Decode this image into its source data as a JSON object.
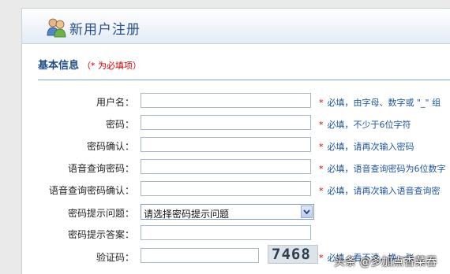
{
  "header": {
    "title": "新用户注册",
    "icon": "users-icon"
  },
  "section": {
    "title": "基本信息",
    "required_note": "（* 为必填项）"
  },
  "form": {
    "star": "*",
    "rows": [
      {
        "label": "用户名：",
        "hint": "必填，由字母、数字或 \"_\" 组"
      },
      {
        "label": "密码：",
        "hint": "必填，不少于6位字符"
      },
      {
        "label": "密码确认：",
        "hint": "必填，请再次输入密码"
      },
      {
        "label": "语音查询密码：",
        "hint": "必填，语音查询密码为6位数字"
      },
      {
        "label": "语音查询密码确认：",
        "hint": "必填，请再次输入语音查询密"
      },
      {
        "label": "密码提示问题：",
        "select_value": "请选择密码提示问题"
      },
      {
        "label": "密码提示答案："
      },
      {
        "label": "验证码：",
        "captcha": "7468",
        "hint": "必填，看不清，换一张"
      }
    ]
  },
  "watermark": "头条 @多加点香菜吞"
}
